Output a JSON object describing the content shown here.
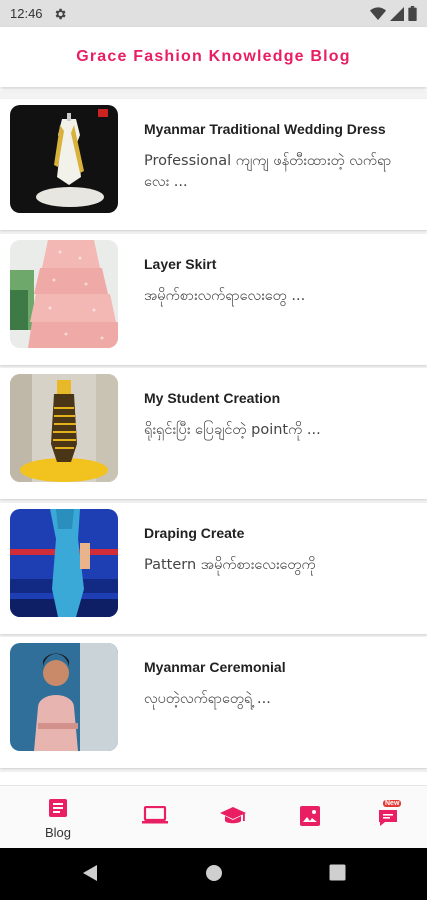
{
  "status_bar": {
    "time": "12:46",
    "icons": [
      "gear-icon",
      "wifi-icon",
      "signal-icon",
      "battery-icon"
    ]
  },
  "app_bar": {
    "title": "Grace Fashion Knowledge Blog"
  },
  "posts": [
    {
      "title": "Myanmar Traditional Wedding Dress",
      "excerpt": "Professional ကျကျ ဖန်တီးထားတဲ့ လက်ရာလေး ..."
    },
    {
      "title": "Layer Skirt",
      "excerpt": "အမိုက်စားလက်ရာလေးတွေ ..."
    },
    {
      "title": "My Student Creation",
      "excerpt": "ရိုးရှင်းပြီး ပြေချင်တဲ့ pointကို ..."
    },
    {
      "title": "Draping Create",
      "excerpt": "Pattern အမိုက်စားလေးတွေကို"
    },
    {
      "title": "Myanmar Ceremonial",
      "excerpt": "လုပတဲ့လက်ရာတွေရဲ့ ..."
    }
  ],
  "bottom_nav": {
    "items": [
      {
        "label": "Blog",
        "icon": "article-icon",
        "active": true
      },
      {
        "icon": "laptop-icon"
      },
      {
        "icon": "graduation-cap-icon"
      },
      {
        "icon": "image-icon"
      },
      {
        "icon": "new-chat-icon",
        "badge": "New"
      }
    ]
  },
  "colors": {
    "accent": "#e91e63",
    "status_bar_bg": "#e0e0e0",
    "list_bg": "#f3f3f3",
    "system_nav_bg": "#000000"
  }
}
